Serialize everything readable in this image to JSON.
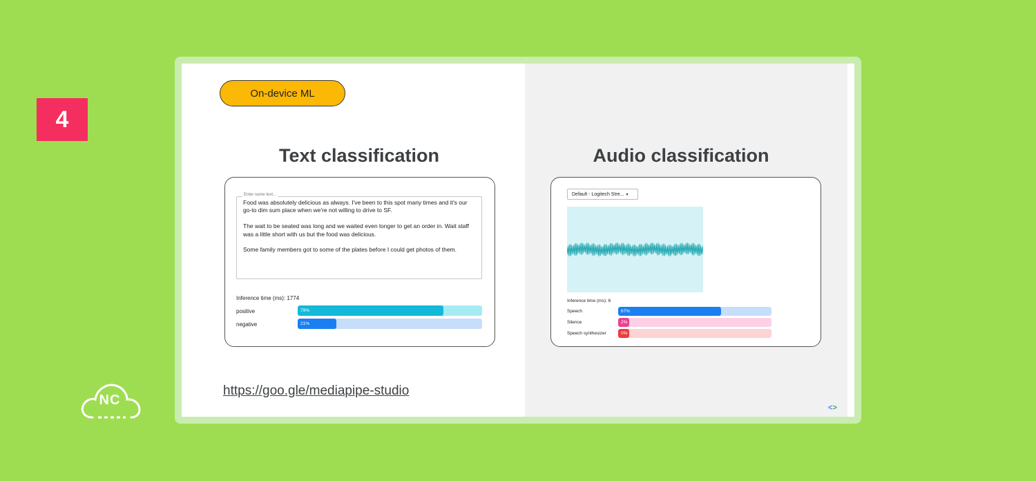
{
  "slide_number": "4",
  "brand_logo_text": "NC",
  "tag": "On-device ML",
  "text_section": {
    "title": "Text classification",
    "input_label": "Enter some text...",
    "input_value": "Food was absolutely delicious as always. I've been to this spot many times and it's our go-to dim sum place when we're not willing to drive to SF.\n\nThe wait to be seated was long and we waited even longer to get an order in. Wait staff was a little short with us but the food was delicious.\n\nSome family members got to some of the plates before I could get photos of them.",
    "inference": "Inference time (ms): 1774",
    "results": [
      {
        "label": "positive",
        "value_text": "79%",
        "value": 0.79,
        "fill": "#13b9d8",
        "track": "#a6ebf3"
      },
      {
        "label": "negative",
        "value_text": "21%",
        "value": 0.21,
        "fill": "#1a7ff0",
        "track": "#c6def9"
      }
    ]
  },
  "audio_section": {
    "title": "Audio classification",
    "device_select": "Default - Logitech Stre...",
    "inference": "Inference time (ms): 6",
    "results": [
      {
        "label": "Speech",
        "value_text": "67%",
        "value": 0.67,
        "fill": "#1a7ff0",
        "track": "#c6def9"
      },
      {
        "label": "Silence",
        "value_text": "2%",
        "value": 0.02,
        "fill": "#e8438f",
        "track": "#fdd0e6"
      },
      {
        "label": "Speech synthesizer",
        "value_text": "0%",
        "value": 0.0,
        "fill": "#ef3b3b",
        "track": "#fdd3d3"
      }
    ]
  },
  "link": "https://goo.gle/mediapipe-studio"
}
